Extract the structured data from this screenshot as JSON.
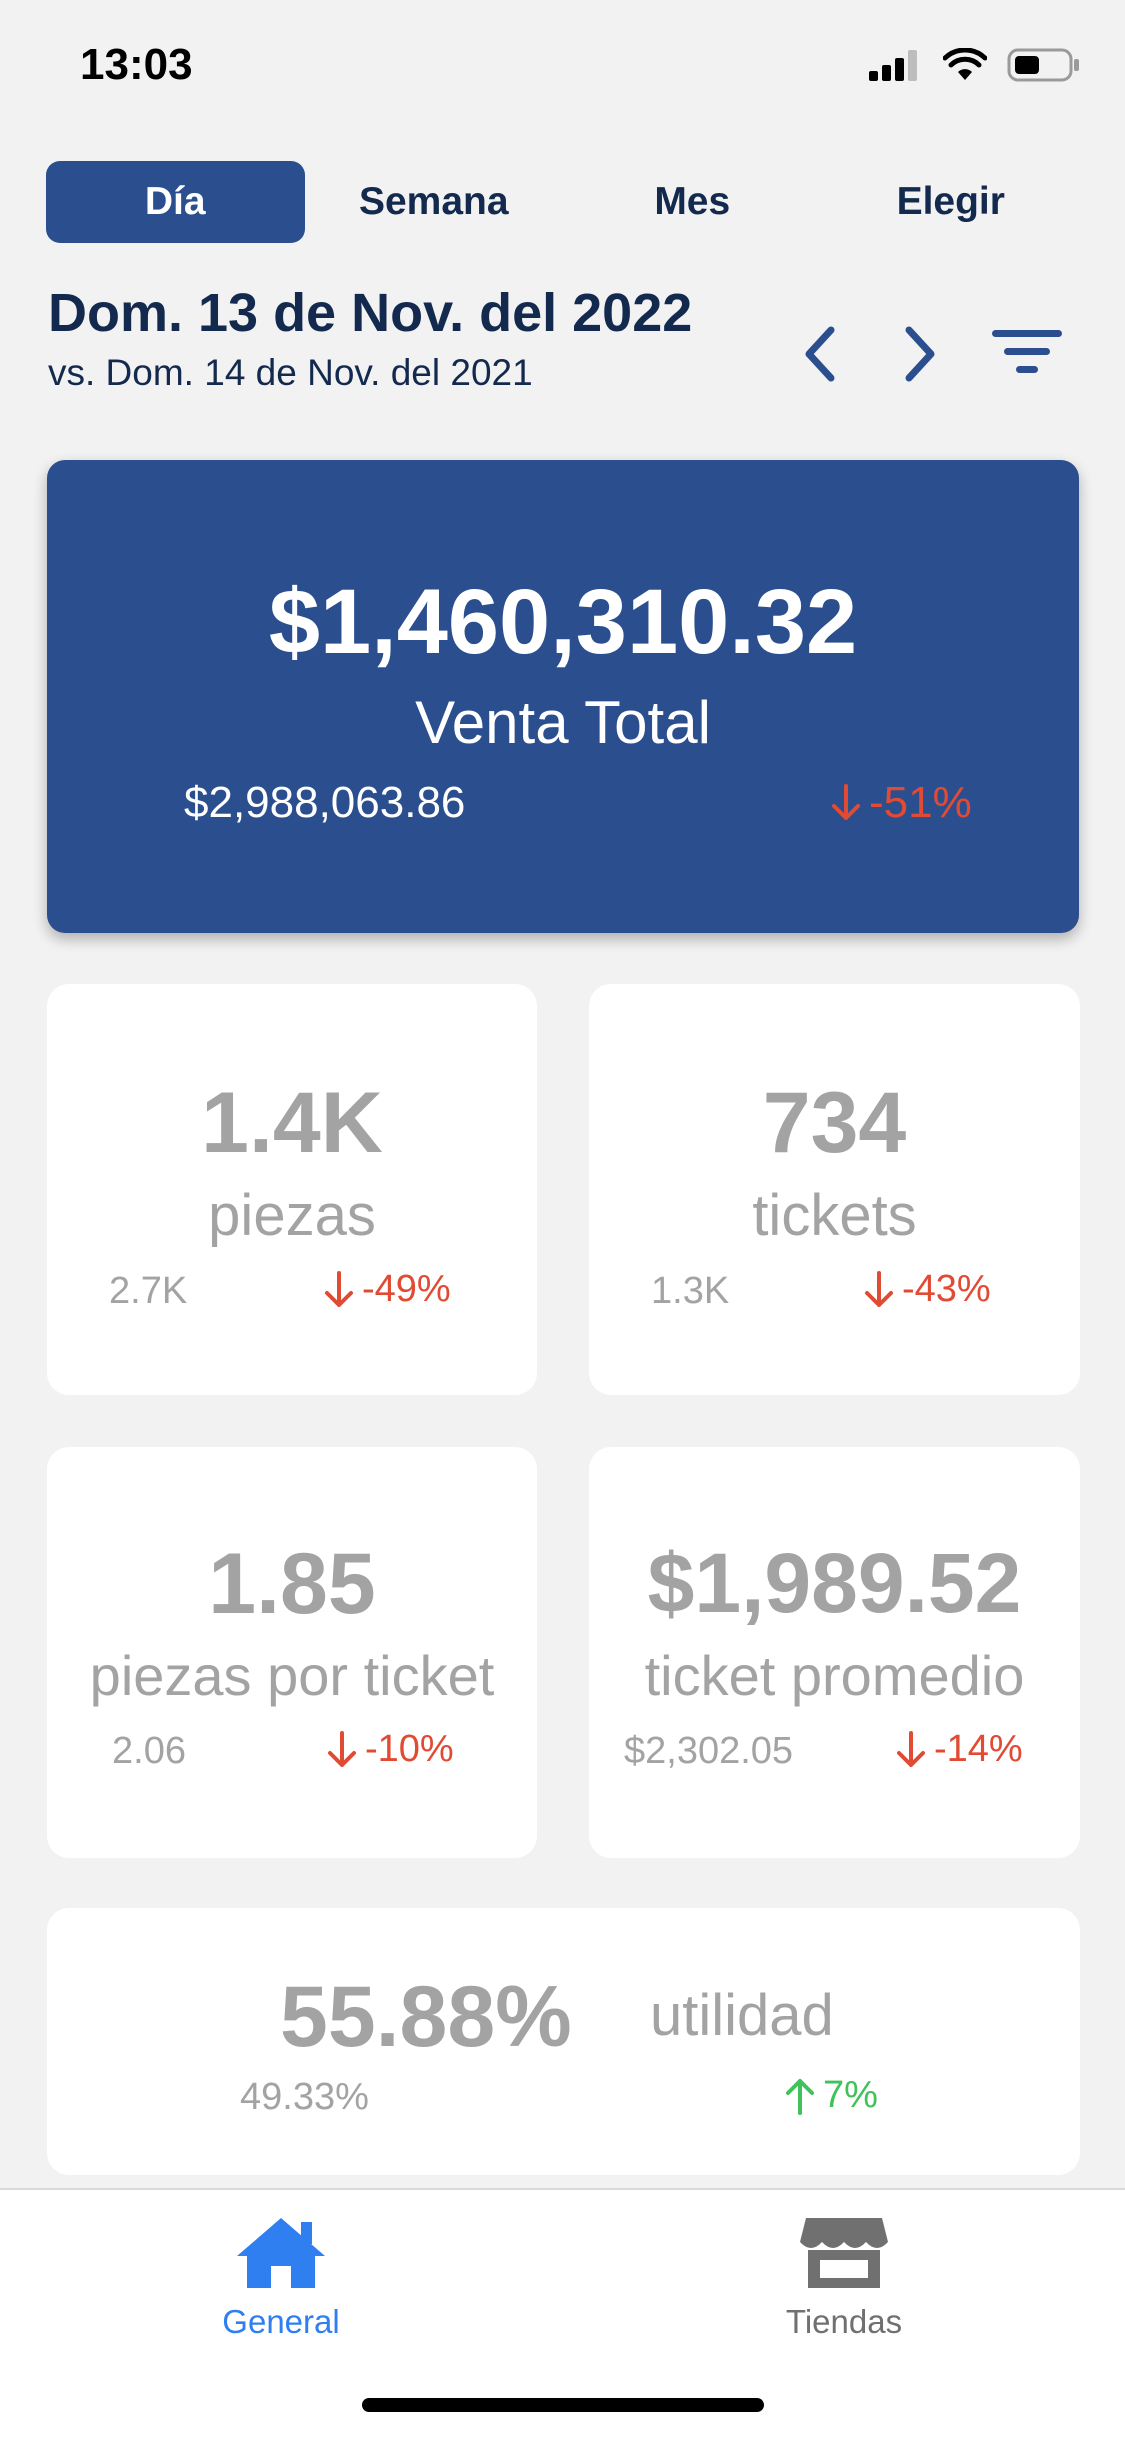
{
  "status_bar": {
    "time": "13:03"
  },
  "tabs": [
    {
      "label": "Día",
      "active": true
    },
    {
      "label": "Semana",
      "active": false
    },
    {
      "label": "Mes",
      "active": false
    },
    {
      "label": "Elegir",
      "active": false
    }
  ],
  "date_header": {
    "current": "Dom. 13 de Nov. del 2022",
    "comparison": "vs. Dom. 14 de Nov. del 2021"
  },
  "total_sales": {
    "value": "$1,460,310.32",
    "label": "Venta Total",
    "previous": "$2,988,063.86",
    "change": "-51%",
    "trend": "down"
  },
  "metrics": {
    "pieces": {
      "value": "1.4K",
      "label": "piezas",
      "previous": "2.7K",
      "change": "-49%",
      "trend": "down"
    },
    "tickets": {
      "value": "734",
      "label": "tickets",
      "previous": "1.3K",
      "change": "-43%",
      "trend": "down"
    },
    "pieces_per_ticket": {
      "value": "1.85",
      "label": "piezas por ticket",
      "previous": "2.06",
      "change": "-10%",
      "trend": "down"
    },
    "avg_ticket": {
      "value": "$1,989.52",
      "label": "ticket promedio",
      "previous": "$2,302.05",
      "change": "-14%",
      "trend": "down"
    },
    "profit": {
      "value": "55.88%",
      "label": "utilidad",
      "previous": "49.33%",
      "change": "7%",
      "trend": "up"
    }
  },
  "bottom_nav": [
    {
      "label": "General",
      "icon": "home-icon",
      "active": true
    },
    {
      "label": "Tiendas",
      "icon": "store-icon",
      "active": false
    }
  ],
  "colors": {
    "primary": "#2b4f8e",
    "navy_text": "#13294d",
    "negative": "#e24b33",
    "positive": "#3fc25a",
    "muted": "#a3a3a3",
    "active_nav": "#2f7ff0",
    "inactive_nav": "#707070"
  }
}
